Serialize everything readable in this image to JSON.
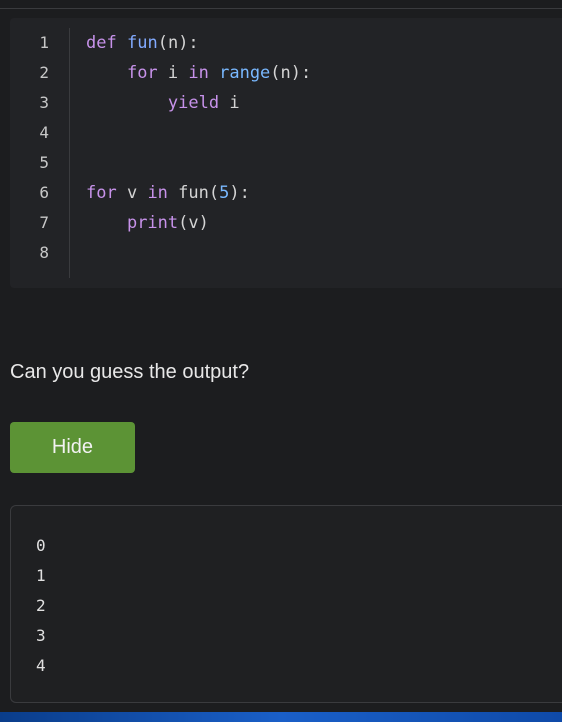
{
  "code": {
    "line_numbers": [
      "1",
      "2",
      "3",
      "4",
      "5",
      "6",
      "7",
      "8"
    ],
    "lines": {
      "l1": {
        "kw_def": "def",
        "name": "fun",
        "open": "(",
        "arg": "n",
        "close": "):"
      },
      "l2": {
        "indent": "    ",
        "kw_for": "for",
        "var": " i ",
        "kw_in": "in",
        "builtin": " range",
        "open": "(",
        "arg": "n",
        "close": "):"
      },
      "l3": {
        "indent": "        ",
        "kw_yield": "yield",
        "var": " i"
      },
      "l6": {
        "kw_for": "for",
        "var": " v ",
        "kw_in": "in",
        "call": " fun",
        "open": "(",
        "num": "5",
        "close": "):"
      },
      "l7": {
        "indent": "    ",
        "builtin": "print",
        "open": "(",
        "arg": "v",
        "close": ")"
      }
    }
  },
  "question": "Can you guess the output?",
  "hide_button_label": "Hide",
  "output_lines": [
    "0",
    "1",
    "2",
    "3",
    "4"
  ],
  "colors": {
    "background": "#1c1d1f",
    "code_background": "#222326",
    "button": "#5c9335",
    "keyword": "#c792ea",
    "builtin": "#79b8ff"
  }
}
